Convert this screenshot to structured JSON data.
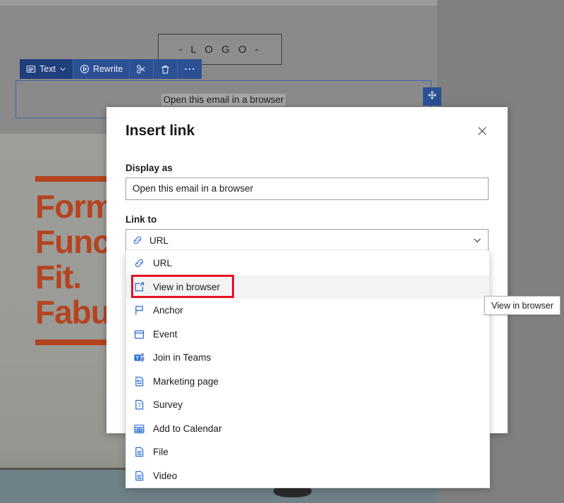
{
  "editor": {
    "logo_text": "-  L O G O  -",
    "toolbar": {
      "text_label": "Text",
      "rewrite_label": "Rewrite",
      "cut_icon": "scissors-icon",
      "delete_icon": "trash-icon",
      "more_icon": "ellipsis-icon",
      "text_icon": "text-block-icon",
      "rewrite_icon": "rewrite-icon",
      "chevron_icon": "chevron-down-icon"
    },
    "banner": {
      "link_text": "Open this email in a browser",
      "move_handle_icon": "move-arrows-icon"
    },
    "hero": {
      "line1": "Form.",
      "line2": "Func.",
      "line3": "Fit.",
      "line4": "Fabulous."
    }
  },
  "dialog": {
    "title": "Insert link",
    "close_icon": "close-icon",
    "display_as": {
      "label": "Display as",
      "value": "Open this email in a browser",
      "placeholder": "Display as"
    },
    "link_to": {
      "label": "Link to",
      "selected": "URL",
      "selected_icon": "link-icon",
      "chevron_icon": "chevron-down-icon"
    }
  },
  "dropdown": {
    "items": [
      {
        "label": "URL",
        "icon": "link-icon",
        "hovered": false
      },
      {
        "label": "View in browser",
        "icon": "open-window-icon",
        "hovered": true
      },
      {
        "label": "Anchor",
        "icon": "flag-icon",
        "hovered": false
      },
      {
        "label": "Event",
        "icon": "calendar-icon",
        "hovered": false
      },
      {
        "label": "Join in Teams",
        "icon": "teams-icon",
        "hovered": false
      },
      {
        "label": "Marketing page",
        "icon": "page-icon",
        "hovered": false
      },
      {
        "label": "Survey",
        "icon": "survey-icon",
        "hovered": false
      },
      {
        "label": "Add to Calendar",
        "icon": "calendar-add-icon",
        "hovered": false
      },
      {
        "label": "File",
        "icon": "file-icon",
        "hovered": false
      },
      {
        "label": "Video",
        "icon": "video-file-icon",
        "hovered": false
      }
    ]
  },
  "tooltip": {
    "text": "View in browser"
  },
  "colors": {
    "annotation": "#e81123",
    "toolbar_blue": "#2b5094",
    "icon_blue": "#2d6fd1",
    "hero_orange": "#b4441f",
    "hover_gray": "#f3f3f3"
  }
}
